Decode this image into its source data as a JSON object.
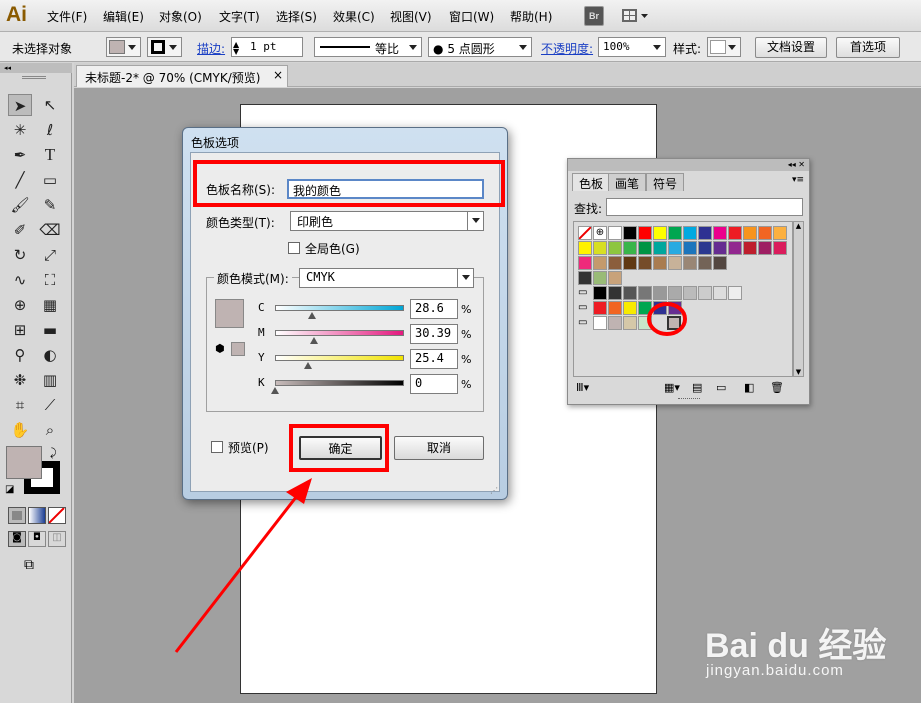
{
  "app": {
    "logo": "Ai"
  },
  "menu": [
    "文件(F)",
    "编辑(E)",
    "对象(O)",
    "文字(T)",
    "选择(S)",
    "效果(C)",
    "视图(V)",
    "窗口(W)",
    "帮助(H)"
  ],
  "toolbar_br": "Br",
  "control": {
    "no_selection": "未选择对象",
    "stroke_label": "描边:",
    "stroke_value": "1 pt",
    "profile": "等比",
    "brush": "5 点圆形",
    "opacity_label": "不透明度:",
    "opacity_value": "100%",
    "style_label": "样式:",
    "doc_setup": "文档设置",
    "prefs": "首选项"
  },
  "tab": {
    "title": "未标题-2* @ 70% (CMYK/预览)",
    "close": "×"
  },
  "dialog": {
    "title": "色板选项",
    "name_label": "色板名称(S):",
    "name_value": "我的颜色",
    "type_label": "颜色类型(T):",
    "type_value": "印刷色",
    "global_label": "全局色(G)",
    "mode_label": "颜色模式(M):",
    "mode_value": "CMYK",
    "channels": [
      {
        "key": "C",
        "value": "28.6",
        "pos": 0.286
      },
      {
        "key": "M",
        "value": "30.39",
        "pos": 0.3039
      },
      {
        "key": "Y",
        "value": "25.4",
        "pos": 0.254
      },
      {
        "key": "K",
        "value": "0",
        "pos": 0.0
      }
    ],
    "pct": "%",
    "preview_label": "预览(P)",
    "ok": "确定",
    "cancel": "取消",
    "swatch_color": "#bfb3b2"
  },
  "swatches_panel": {
    "tabs": [
      "色板",
      "画笔",
      "符号"
    ],
    "search_label": "查找:",
    "colors": [
      "#ffffff",
      "#000000",
      "#ff0000",
      "#ffff00",
      "#00a650",
      "#00a9e0",
      "#2e3192",
      "#ec008c",
      "#ed1c24",
      "#f7941d",
      "#f26522",
      "#fbb040",
      "#fff200",
      "#d7df23",
      "#8dc63f",
      "#39b54a",
      "#009444",
      "#00a79d",
      "#27aae1",
      "#1c75bc",
      "#2b3990",
      "#662d91",
      "#92278f",
      "#be1e2d",
      "#9e1f63",
      "#da1c5c",
      "#ee2a7b",
      "#c49a6c",
      "#8b5e3c",
      "#603913",
      "#754c29",
      "#a97c50",
      "#c7b299",
      "#998675",
      "#736357",
      "#534741",
      "#bfb3b2",
      "#231f20"
    ]
  },
  "watermark": {
    "brand": "Bai du 经验",
    "url": "jingyan.baidu.com"
  }
}
